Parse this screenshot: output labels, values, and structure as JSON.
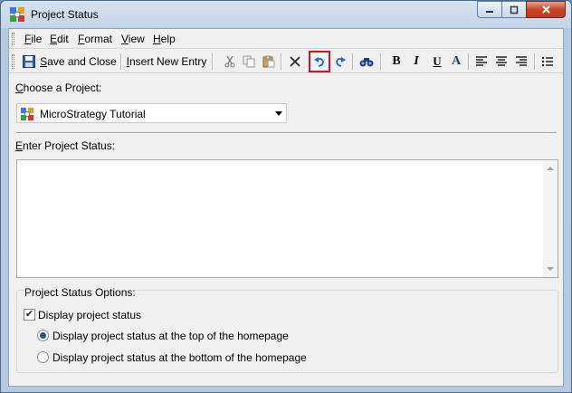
{
  "window": {
    "title": "Project Status",
    "icon": "microstrategy-project-icon",
    "buttons": {
      "minimize": "minimize-icon",
      "maximize": "maximize-icon",
      "close": "close-icon"
    }
  },
  "menu": {
    "items": [
      {
        "label": "File",
        "mnemonic": "F",
        "rest": "ile"
      },
      {
        "label": "Edit",
        "mnemonic": "E",
        "rest": "dit"
      },
      {
        "label": "Format",
        "mnemonic": "F",
        "rest": "ormat"
      },
      {
        "label": "View",
        "mnemonic": "V",
        "rest": "iew"
      },
      {
        "label": "Help",
        "mnemonic": "H",
        "rest": "elp"
      }
    ]
  },
  "toolbar": {
    "save_close_mnemonic": "S",
    "save_close_rest": "ave and Close",
    "insert_entry_mnemonic": "I",
    "insert_entry_rest": "nsert New Entry",
    "icons": [
      "save-icon",
      "cut-icon",
      "copy-icon",
      "paste-icon",
      "delete-icon",
      "undo-icon",
      "redo-icon",
      "find-icon",
      "bold-icon",
      "italic-icon",
      "underline-icon",
      "font-color-icon",
      "align-left-icon",
      "align-center-icon",
      "align-right-icon",
      "bullet-list-icon"
    ],
    "highlight_color": "#d6141a"
  },
  "project": {
    "label_mnemonic": "C",
    "label_rest": "hoose a Project:",
    "selected": "MicroStrategy Tutorial"
  },
  "status": {
    "label_mnemonic": "E",
    "label_rest": "nter Project Status:",
    "value": ""
  },
  "options": {
    "legend": "Project Status Options:",
    "display_checkbox_label": "Display project status",
    "display_checked": true,
    "radio_top_label": "Display project status at the top of the homepage",
    "radio_bottom_label": "Display project status at the bottom of the homepage",
    "selected_position": "top"
  }
}
